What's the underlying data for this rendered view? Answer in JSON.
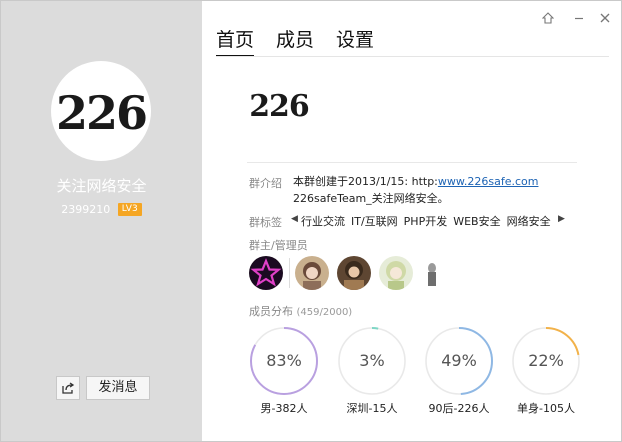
{
  "profile": {
    "avatar_text": "226",
    "group_name": "关注网络安全",
    "group_id": "2399210",
    "level": "LV3",
    "share_icon": "share-icon",
    "message_button": "发消息"
  },
  "window_controls": [
    "pin-icon",
    "minimize-icon",
    "close-icon"
  ],
  "tabs": [
    {
      "label": "首页",
      "active": true
    },
    {
      "label": "成员",
      "active": false
    },
    {
      "label": "设置",
      "active": false
    }
  ],
  "home": {
    "logo_text": "226",
    "intro_label": "群介绍",
    "intro_text_1": "本群创建于2013/1/15:  http:",
    "intro_link": "www.226safe.com",
    "intro_text_2": "226safeTeam_关注网络安全。",
    "tags_label": "群标签",
    "tags": [
      "行业交流",
      "IT/互联网",
      "PHP开发",
      "WEB安全",
      "网络安全"
    ],
    "admins_label": "群主/管理员",
    "distribution_label": "成员分布",
    "distribution_count": "(459/2000)",
    "distribution": [
      {
        "pct": "83%",
        "value": 0.83,
        "label": "男-382人",
        "color": "#b9a0e0"
      },
      {
        "pct": "3%",
        "value": 0.03,
        "label": "深圳-15人",
        "color": "#7fd6c5"
      },
      {
        "pct": "49%",
        "value": 0.49,
        "label": "90后-226人",
        "color": "#8fb8e4"
      },
      {
        "pct": "22%",
        "value": 0.22,
        "label": "单身-105人",
        "color": "#f2b24a"
      }
    ]
  },
  "colors": {
    "left_panel": "#dcdcdc",
    "level_badge": "#f5a623",
    "link": "#1e64b4"
  }
}
